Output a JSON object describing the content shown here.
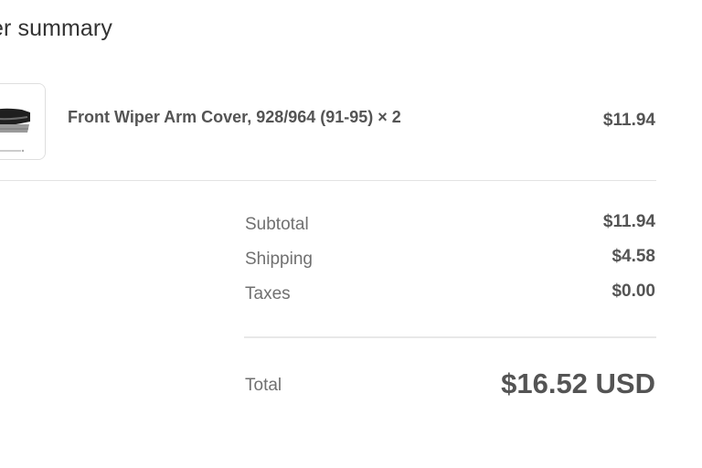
{
  "summary": {
    "title": "der summary"
  },
  "product": {
    "name": "Front Wiper Arm Cover, 928/964 (91-95) × 2",
    "price": "$11.94",
    "thumbnail_icon": "wiper-arm-cover-product-image"
  },
  "totals": {
    "subtotal_label": "Subtotal",
    "subtotal_value": "$11.94",
    "shipping_label": "Shipping",
    "shipping_value": "$4.58",
    "taxes_label": "Taxes",
    "taxes_value": "$0.00",
    "total_label": "Total",
    "total_value": "$16.52 USD"
  },
  "colors": {
    "text_primary": "#545454",
    "text_secondary": "#707070",
    "divider": "#e3e3e3",
    "thumbnail_border": "#dedede"
  }
}
